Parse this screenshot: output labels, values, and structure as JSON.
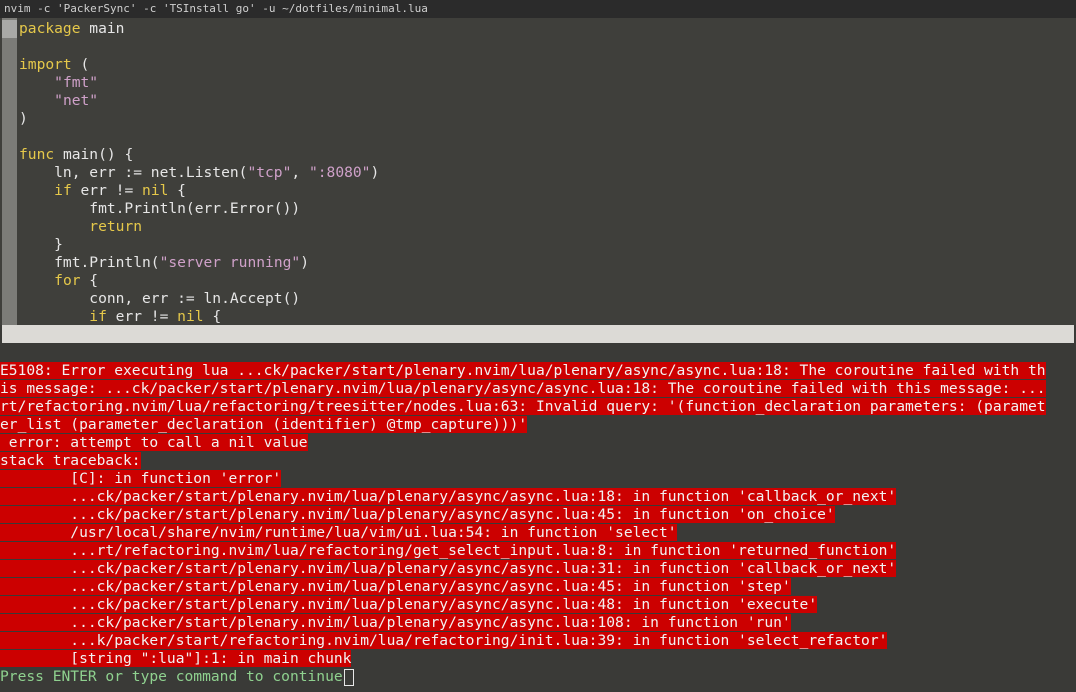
{
  "window": {
    "title": "nvim -c 'PackerSync' -c 'TSInstall go' -u ~/dotfiles/minimal.lua"
  },
  "editor": {
    "lines": [
      [
        {
          "t": "package",
          "c": "kw"
        },
        {
          "t": " main",
          "c": ""
        }
      ],
      [],
      [
        {
          "t": "import",
          "c": "kw"
        },
        {
          "t": " (",
          "c": ""
        }
      ],
      [
        {
          "t": "    ",
          "c": ""
        },
        {
          "t": "\"fmt\"",
          "c": "st"
        }
      ],
      [
        {
          "t": "    ",
          "c": ""
        },
        {
          "t": "\"net\"",
          "c": "st"
        }
      ],
      [
        {
          "t": ")",
          "c": ""
        }
      ],
      [],
      [
        {
          "t": "func",
          "c": "kw"
        },
        {
          "t": " main() {",
          "c": ""
        }
      ],
      [
        {
          "t": "    ln, err := net.Listen(",
          "c": ""
        },
        {
          "t": "\"tcp\"",
          "c": "st"
        },
        {
          "t": ", ",
          "c": ""
        },
        {
          "t": "\":8080\"",
          "c": "st"
        },
        {
          "t": ")",
          "c": ""
        }
      ],
      [
        {
          "t": "    ",
          "c": ""
        },
        {
          "t": "if",
          "c": "kw"
        },
        {
          "t": " err != ",
          "c": ""
        },
        {
          "t": "nil",
          "c": "kw"
        },
        {
          "t": " {",
          "c": ""
        }
      ],
      [
        {
          "t": "        fmt.Println(err.Error())",
          "c": ""
        }
      ],
      [
        {
          "t": "        ",
          "c": ""
        },
        {
          "t": "return",
          "c": "kw"
        }
      ],
      [
        {
          "t": "    }",
          "c": ""
        }
      ],
      [
        {
          "t": "    fmt.Println(",
          "c": ""
        },
        {
          "t": "\"server running\"",
          "c": "st"
        },
        {
          "t": ")",
          "c": ""
        }
      ],
      [
        {
          "t": "    ",
          "c": ""
        },
        {
          "t": "for",
          "c": "kw"
        },
        {
          "t": " {",
          "c": ""
        }
      ],
      [
        {
          "t": "        conn, err := ln.Accept()",
          "c": ""
        }
      ],
      [
        {
          "t": "        ",
          "c": ""
        },
        {
          "t": "if",
          "c": "kw"
        },
        {
          "t": " err != ",
          "c": ""
        },
        {
          "t": "nil",
          "c": "kw"
        },
        {
          "t": " {",
          "c": ""
        }
      ]
    ]
  },
  "messages": {
    "error_lines": [
      "E5108: Error executing lua ...ck/packer/start/plenary.nvim/lua/plenary/async/async.lua:18: The coroutine failed with th",
      "is message: ...ck/packer/start/plenary.nvim/lua/plenary/async/async.lua:18: The coroutine failed with this message: ...",
      "rt/refactoring.nvim/lua/refactoring/treesitter/nodes.lua:63: Invalid query: '(function_declaration parameters: (paramet",
      "er_list (parameter_declaration (identifier) @tmp_capture)))'",
      " error: attempt to call a nil value",
      "stack traceback:",
      "        [C]: in function 'error'",
      "        ...ck/packer/start/plenary.nvim/lua/plenary/async/async.lua:18: in function 'callback_or_next'",
      "        ...ck/packer/start/plenary.nvim/lua/plenary/async/async.lua:45: in function 'on_choice'",
      "        /usr/local/share/nvim/runtime/lua/vim/ui.lua:54: in function 'select'",
      "        ...rt/refactoring.nvim/lua/refactoring/get_select_input.lua:8: in function 'returned_function'",
      "        ...ck/packer/start/plenary.nvim/lua/plenary/async/async.lua:31: in function 'callback_or_next'",
      "        ...ck/packer/start/plenary.nvim/lua/plenary/async/async.lua:45: in function 'step'",
      "        ...ck/packer/start/plenary.nvim/lua/plenary/async/async.lua:48: in function 'execute'",
      "        ...ck/packer/start/plenary.nvim/lua/plenary/async/async.lua:108: in function 'run'",
      "        ...k/packer/start/refactoring.nvim/lua/refactoring/init.lua:39: in function 'select_refactor'",
      "        [string \":lua\"]:1: in main chunk"
    ],
    "prompt": "Press ENTER or type command to continue"
  },
  "colors": {
    "error_bg": "#cc0000",
    "keyword": "#e5c84a",
    "string": "#cfa1c9",
    "prompt": "#8fd18f"
  }
}
